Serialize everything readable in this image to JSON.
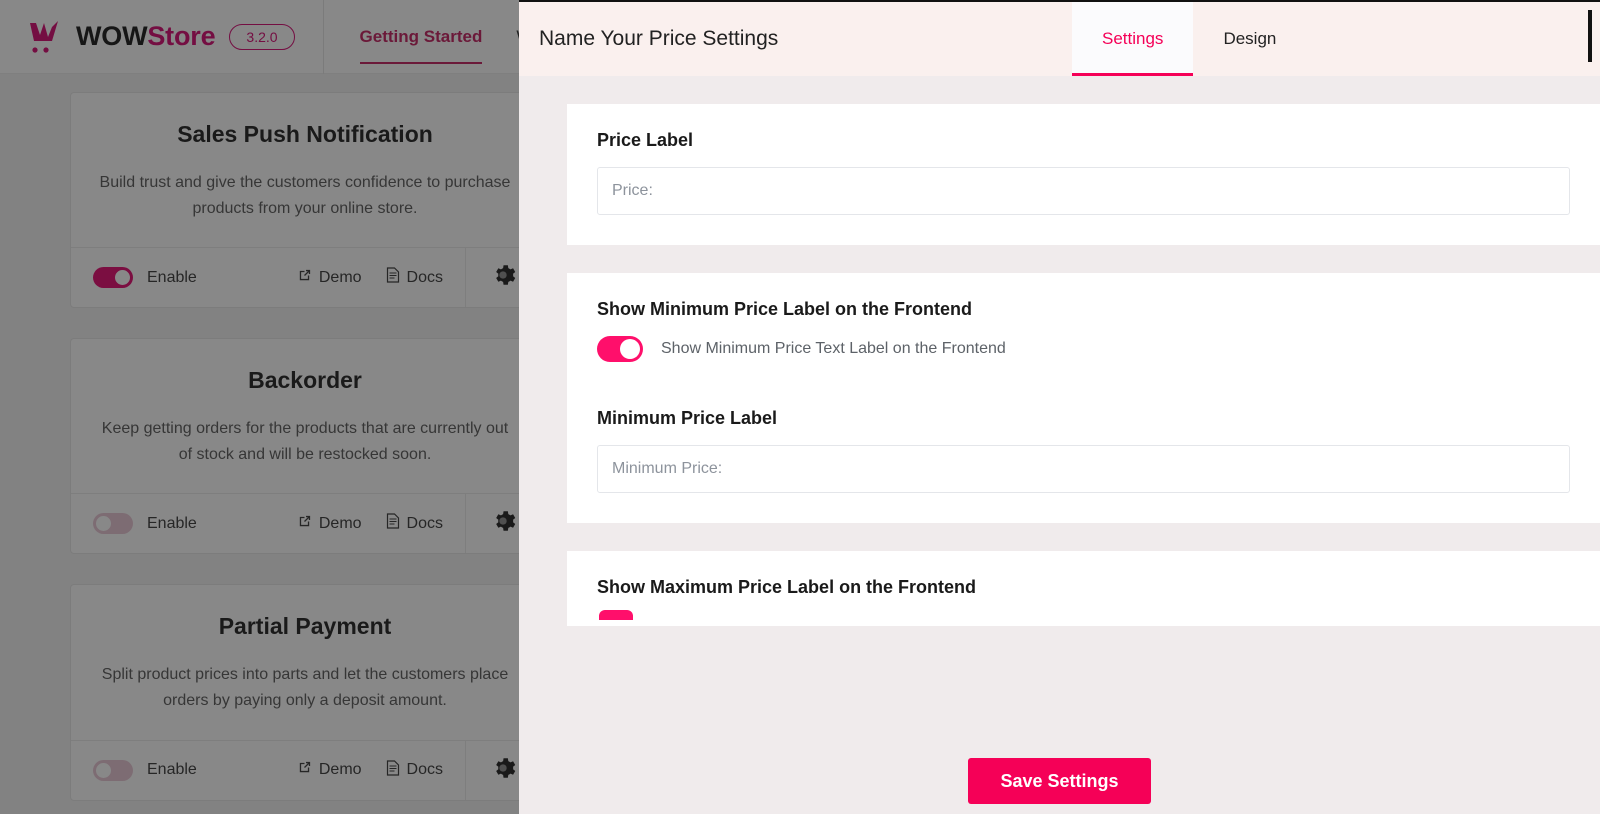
{
  "app": {
    "brand": {
      "logo_icon": "wow-cart-logo-icon",
      "name_part1": "WOW",
      "name_part2": "Store",
      "version": "3.2.0"
    },
    "nav": [
      {
        "label": "Getting Started",
        "active": true
      },
      {
        "label": "W",
        "active": false
      }
    ],
    "cards": [
      {
        "title": "Sales Push Notification",
        "description": "Build trust and give the customers confidence to purchase products from your online store.",
        "enable_label": "Enable",
        "enabled": true,
        "demo_label": "Demo",
        "demo_icon": "external-link-icon",
        "docs_label": "Docs",
        "docs_icon": "document-icon",
        "settings_icon": "gear-icon"
      },
      {
        "title": "Backorder",
        "description": "Keep getting orders for the products that are currently out of stock and will be restocked soon.",
        "enable_label": "Enable",
        "enabled": false,
        "demo_label": "Demo",
        "demo_icon": "external-link-icon",
        "docs_label": "Docs",
        "docs_icon": "document-icon",
        "settings_icon": "gear-icon"
      },
      {
        "title": "Partial Payment",
        "description": "Split product prices into parts and let the customers place orders by paying only a deposit amount.",
        "enable_label": "Enable",
        "enabled": false,
        "demo_label": "Demo",
        "demo_icon": "external-link-icon",
        "docs_label": "Docs",
        "docs_icon": "document-icon",
        "settings_icon": "gear-icon"
      }
    ]
  },
  "modal": {
    "title": "Name Your Price Settings",
    "tabs": [
      {
        "label": "Settings",
        "active": true
      },
      {
        "label": "Design",
        "active": false
      }
    ],
    "close_icon": "close-icon",
    "sections": [
      {
        "label": "Price Label",
        "input_placeholder": "Price:",
        "input_value": ""
      },
      {
        "label": "Show Minimum Price Label on the Frontend",
        "toggle_caption": "Show Minimum Price Text Label on the Frontend",
        "toggle_on": true,
        "sub_label": "Minimum Price Label",
        "input_placeholder": "Minimum Price:",
        "input_value": ""
      },
      {
        "label": "Show Maximum Price Label on the Frontend",
        "toggle_on": true
      }
    ],
    "footer": {
      "save_label": "Save Settings",
      "accent_color": "#F50057"
    }
  },
  "colors": {
    "brand_pink": "#D6006E",
    "accent_pink": "#F50057",
    "toggle_on": "#FF0F6B",
    "modal_bg": "#F0EBEC",
    "modal_header_bg": "#FAF0EE"
  }
}
